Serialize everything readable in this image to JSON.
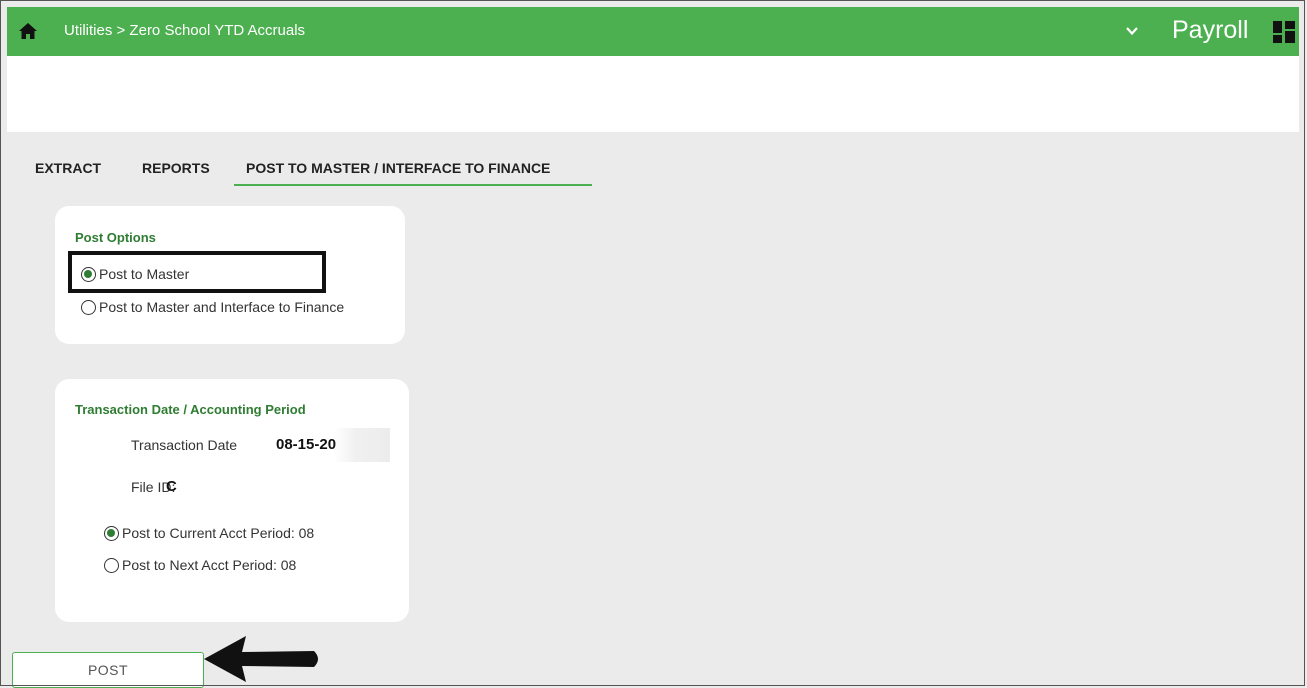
{
  "header": {
    "breadcrumb": "Utilities > Zero School YTD Accruals",
    "module": "Payroll",
    "colors": {
      "brand": "#4caf50",
      "accent_text": "#2e7d32"
    }
  },
  "tabs": [
    {
      "label": "EXTRACT",
      "active": false
    },
    {
      "label": "REPORTS",
      "active": false
    },
    {
      "label": "POST TO MASTER / INTERFACE TO FINANCE",
      "active": true
    }
  ],
  "post_options": {
    "title": "Post Options",
    "options": [
      {
        "label": "Post to Master",
        "selected": true
      },
      {
        "label": "Post to Master and Interface to Finance",
        "selected": false
      }
    ]
  },
  "transaction": {
    "title": "Transaction Date / Accounting Period",
    "date_label": "Transaction Date",
    "date_value": "08-15-20",
    "file_id_label": "File ID:",
    "file_id_value": "C",
    "options": [
      {
        "label": "Post to Current Acct Period: 08",
        "selected": true
      },
      {
        "label": "Post to Next Acct Period: 08",
        "selected": false
      }
    ]
  },
  "actions": {
    "post_label": "POST"
  },
  "icons": {
    "home": "home-icon",
    "chevron": "chevron-down-icon",
    "grid": "grid-icon",
    "arrow": "arrow-left-icon"
  }
}
